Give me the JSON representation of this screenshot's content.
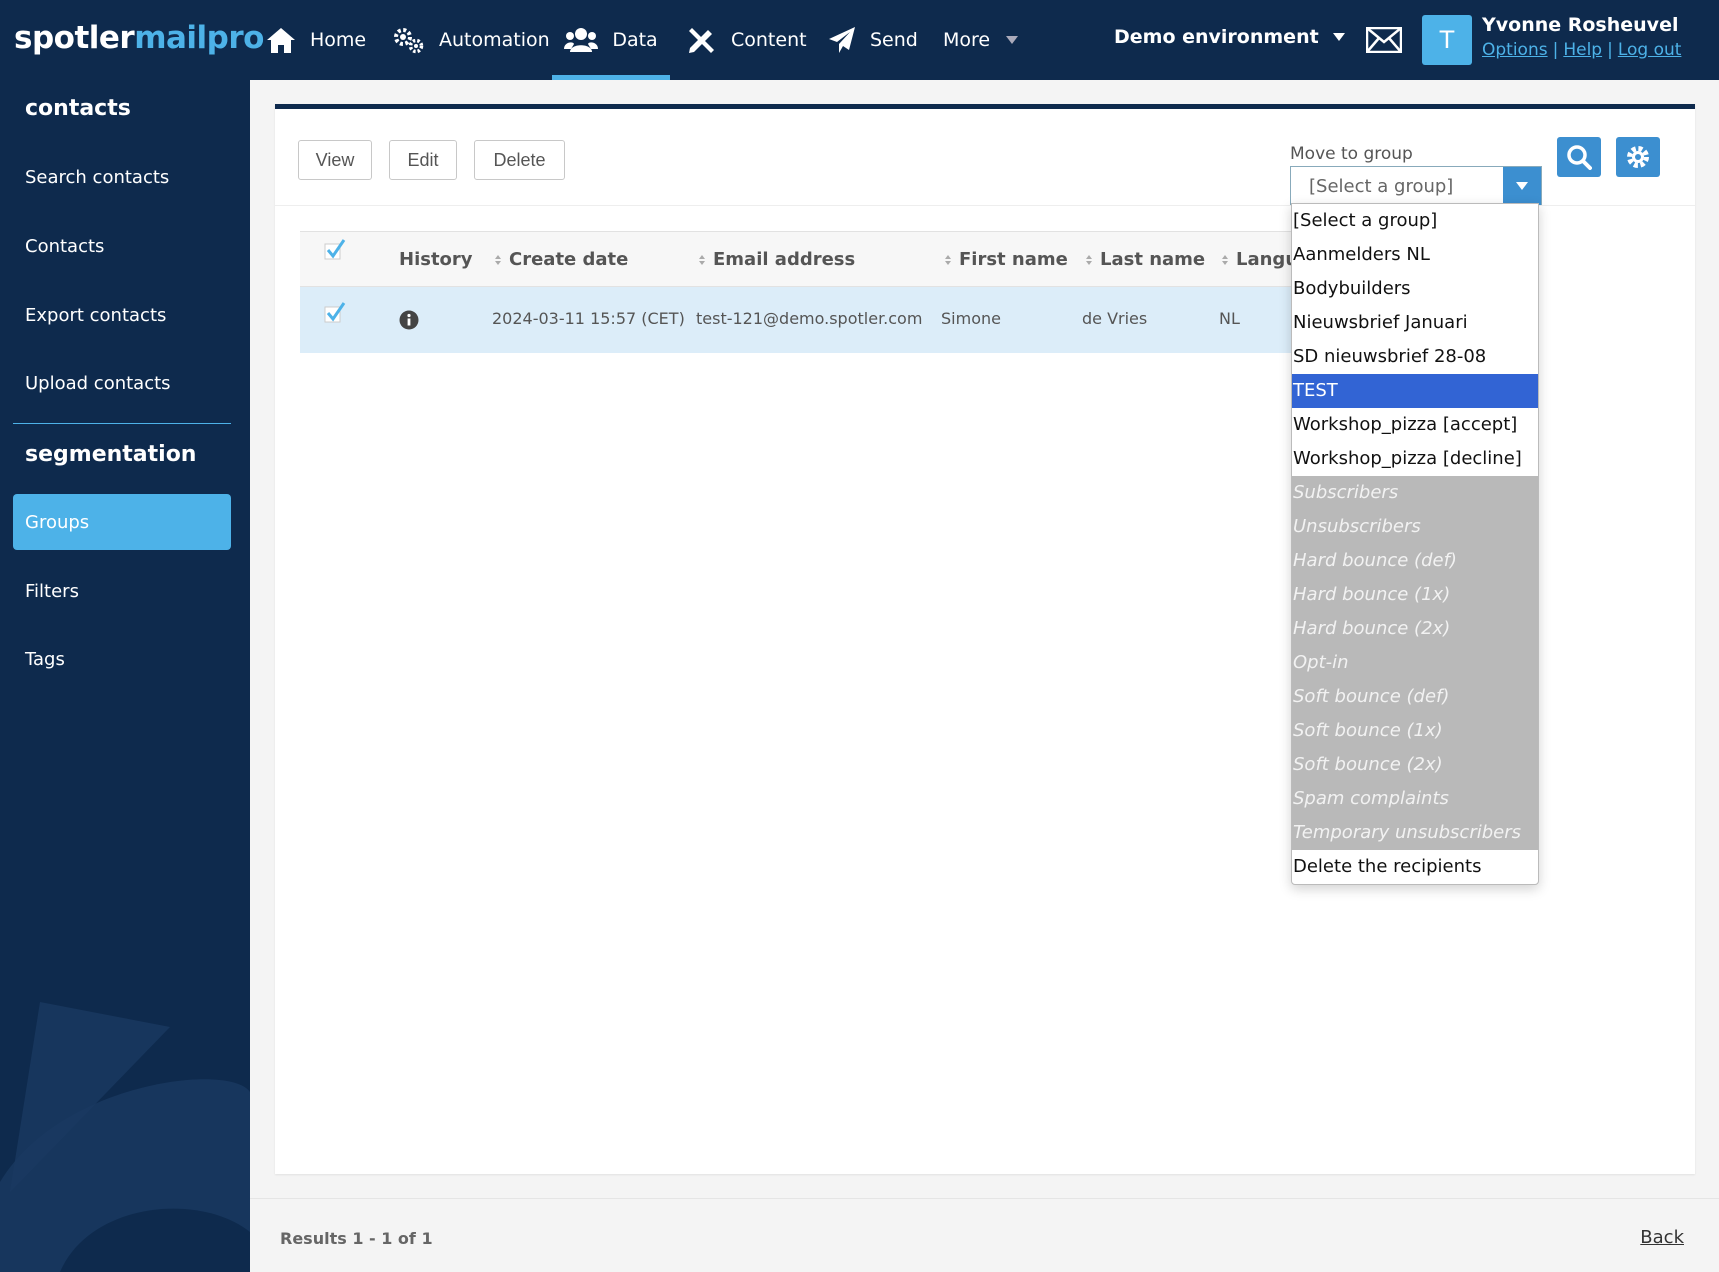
{
  "brand": {
    "part1": "spotler",
    "part2": "mailpro"
  },
  "nav": {
    "home": "Home",
    "automation": "Automation",
    "data": "Data",
    "content": "Content",
    "send": "Send",
    "more": "More"
  },
  "environment": "Demo environment",
  "user": {
    "avatar_letter": "T",
    "name": "Yvonne Rosheuvel",
    "options": "Options",
    "help": "Help",
    "logout": "Log out"
  },
  "sidebar": {
    "contacts_heading": "contacts",
    "contacts_items": [
      "Search contacts",
      "Contacts",
      "Export contacts",
      "Upload contacts"
    ],
    "segmentation_heading": "segmentation",
    "segmentation_items": [
      "Groups",
      "Filters",
      "Tags"
    ],
    "active_item": "Groups"
  },
  "toolbar": {
    "view": "View",
    "edit": "Edit",
    "delete": "Delete",
    "move_label": "Move to group",
    "select_value": "[Select a group]"
  },
  "table": {
    "headers": {
      "history": "History",
      "create_date": "Create date",
      "email": "Email address",
      "first_name": "First name",
      "last_name": "Last name",
      "language": "Langu"
    },
    "rows": [
      {
        "create_date": "2024-03-11 15:57 (CET)",
        "email": "test-121@demo.spotler.com",
        "first_name": "Simone",
        "last_name": "de Vries",
        "language": "NL"
      }
    ]
  },
  "dropdown": {
    "options": [
      "[Select a group]",
      "Aanmelders NL",
      "Bodybuilders",
      "Nieuwsbrief Januari",
      "SD nieuwsbrief 28-08",
      "TEST",
      "Workshop_pizza [accept]",
      "Workshop_pizza [decline]"
    ],
    "highlighted": "TEST",
    "disabled_options": [
      "Subscribers",
      "Unsubscribers",
      "Hard bounce (def)",
      "Hard bounce (1x)",
      "Hard bounce (2x)",
      "Opt-in",
      "Soft bounce (def)",
      "Soft bounce (1x)",
      "Soft bounce (2x)",
      "Spam complaints",
      "Temporary unsubscribers"
    ],
    "final_option": "Delete the recipients"
  },
  "footer": {
    "results": "Results 1 - 1 of 1",
    "back": "Back"
  },
  "colors": {
    "navy": "#0e2a4d",
    "accent": "#4db2e8",
    "button_blue": "#3c8fd0",
    "highlight": "#3264d4"
  },
  "icons": [
    "home-icon",
    "cogs-icon",
    "users-icon",
    "pencil-ruler-icon",
    "paper-plane-icon",
    "envelope-icon",
    "info-icon",
    "search-icon",
    "gear-icon",
    "checkbox-icon"
  ]
}
